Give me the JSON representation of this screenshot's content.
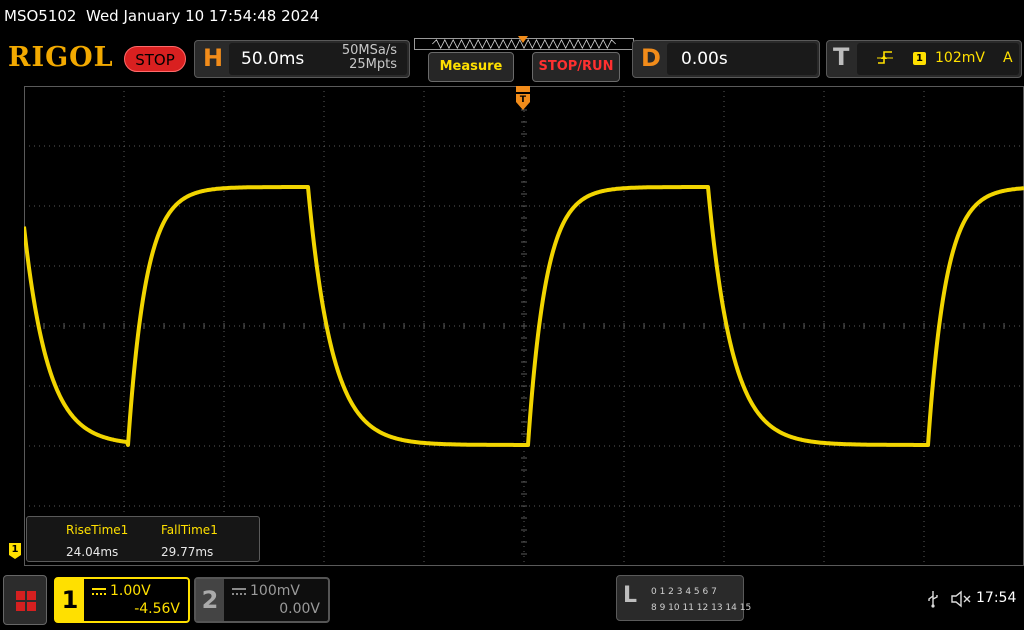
{
  "titlebar": {
    "model": "MSO5102",
    "datetime": "Wed January 10 17:54:48 2024"
  },
  "toolbar": {
    "logo": "RIGOL",
    "run_state": "STOP",
    "horizontal": {
      "letter": "H",
      "timebase": "50.0ms",
      "sample_rate": "50MSa/s",
      "memory_depth": "25Mpts"
    },
    "measure_label": "Measure",
    "stoprun_label": "STOP/RUN",
    "delay": {
      "letter": "D",
      "value": "0.00s"
    },
    "trigger": {
      "letter": "T",
      "edge_icon": "rising-edge-icon",
      "source": "1",
      "level": "102mV",
      "mode": "A"
    }
  },
  "measurements": [
    {
      "name": "RiseTime1",
      "value": "24.04ms"
    },
    {
      "name": "FallTime1",
      "value": "29.77ms"
    }
  ],
  "ch1_ground_marker": "1",
  "channels": [
    {
      "number": "1",
      "coupling_icon": "dc-coupling-icon",
      "scale": "1.00V",
      "offset": "-4.56V",
      "active": true,
      "color": "#ffe000"
    },
    {
      "number": "2",
      "coupling_icon": "dc-coupling-icon",
      "scale": "100mV",
      "offset": "0.00V",
      "active": false,
      "color": "#9a9a9a"
    }
  ],
  "logic_analyzer": {
    "letter": "L",
    "row1": "0 1 2 3   4 5 6 7",
    "row2": "8  9 10 11  12 13 14 15"
  },
  "status": {
    "time": "17:54"
  },
  "colors": {
    "trace": "#ffe000",
    "accent": "#f28c1a",
    "stop": "#d92020",
    "grid": "#5a5a5a"
  },
  "waveform": {
    "period_ms": 200,
    "display_window_ms": 500,
    "high_level_div": 4.15,
    "low_level_div": -0.15,
    "edges": [
      {
        "type": "fall",
        "t_ms": -2
      },
      {
        "type": "rise",
        "t_ms": 52
      },
      {
        "type": "fall",
        "t_ms": 142
      },
      {
        "type": "rise",
        "t_ms": 252
      },
      {
        "type": "fall",
        "t_ms": 342
      },
      {
        "type": "rise",
        "t_ms": 452
      }
    ]
  }
}
